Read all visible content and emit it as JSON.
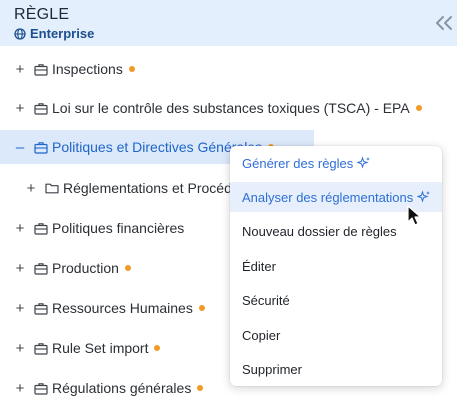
{
  "header": {
    "title": "RÈGLE",
    "subtitle": "Enterprise"
  },
  "tree": [
    {
      "toggle": "+",
      "label": "Inspections",
      "dot": true
    },
    {
      "toggle": "+",
      "label": "Loi sur le contrôle des substances toxiques (TSCA) - EPA",
      "dot": true
    },
    {
      "toggle": "–",
      "label": "Politiques et Directives Générales",
      "dot": true,
      "selected": true
    },
    {
      "toggle": "+",
      "label": "Réglementations et Procédures",
      "dot": false,
      "child": true,
      "icon": "folder-icon"
    },
    {
      "toggle": "+",
      "label": "Politiques financières",
      "dot": false
    },
    {
      "toggle": "+",
      "label": "Production",
      "dot": true
    },
    {
      "toggle": "+",
      "label": "Ressources Humaines",
      "dot": true
    },
    {
      "toggle": "+",
      "label": "Rule Set import",
      "dot": true
    },
    {
      "toggle": "+",
      "label": "Régulations générales",
      "dot": true
    }
  ],
  "context_menu": {
    "items": [
      {
        "label": "Générer des règles",
        "ai": true
      },
      {
        "label": "Analyser des réglementations",
        "ai": true,
        "hovered": true
      },
      {
        "label": "Nouveau dossier de règles"
      },
      {
        "label": "Éditer"
      },
      {
        "label": "Sécurité"
      },
      {
        "label": "Copier"
      },
      {
        "label": "Supprimer"
      }
    ]
  },
  "colors": {
    "accent": "#2066c8",
    "header_bg": "#e3effc",
    "status_dot": "#f39a26",
    "ai_text": "#2f6fd6"
  },
  "icons": {
    "globe": "globe-icon",
    "collapse": "double-chevron-left-icon",
    "ruleset": "briefcase-icon",
    "folder": "folder-icon",
    "sparkle": "sparkle-icon"
  }
}
